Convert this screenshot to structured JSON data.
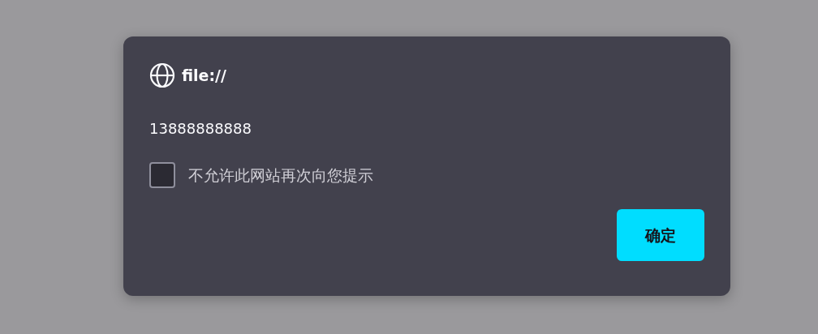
{
  "dialog": {
    "origin": "file://",
    "message": "13888888888",
    "checkbox": {
      "label": "不允许此网站再次向您提示",
      "checked": false
    },
    "buttons": [
      "确定"
    ]
  }
}
